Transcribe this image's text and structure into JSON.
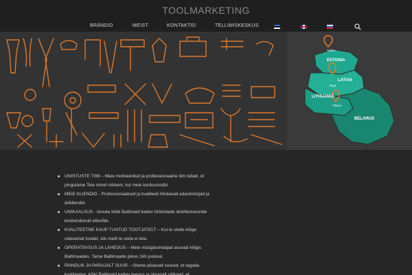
{
  "site": {
    "title": "TOOLMARKETING"
  },
  "nav": {
    "items": [
      "BRÄNDID",
      "MEIST",
      "KONTAKTID",
      "TELLIMISKESKUS"
    ],
    "flags": [
      "flag-estonia",
      "flag-united-kingdom",
      "flag-russia"
    ]
  },
  "map": {
    "countries": [
      "ESTONIA",
      "LATVIA",
      "LITHUANIA",
      "BELARUS"
    ],
    "cities": [
      "Tallinn",
      "Riga",
      "Vilnius"
    ],
    "colors": {
      "baltic": "#1fa88f",
      "belarus": "#19866f",
      "pin": "#e07a2c"
    }
  },
  "content": {
    "items": [
      "UNISTUSTE TIIM – Meie motiveeritud ja professionaalne tiim lubab, et pingutame Teie nimel rohkem, kui meie konkurendid.",
      "MEIE KLIENDID - Professionaalsed ja kvaliteeti hindavad edasimüüjad ja ärikliendid.",
      "UNIKAALSUS - Ainuke kõiki Baltimaid kattev tööriistade distributsioonile keskendunud ettevõte.",
      "KVALITEETNE KAUP TUNTUD TOOTJATELT – Kui te otsite kõige odavamat toodet, siis meilt te seda ei leia.",
      "OPERATIIVSUS JA LÄHEDUS – Meie müügiesindajad asuvad kõigis Baltimaades. Tarne Baltimaade piires 24h jooksul.",
      "PAINDLIK JA PARAJALT SUUR – Oleme piisavalt suured, et tagada kvaliteetne, kõiki Baltimaid kattev teenus ja piisavalt väiksed, et"
    ]
  },
  "colors": {
    "accent": "#e07a2c",
    "background": "#262626",
    "header": "#1f1f1f"
  }
}
